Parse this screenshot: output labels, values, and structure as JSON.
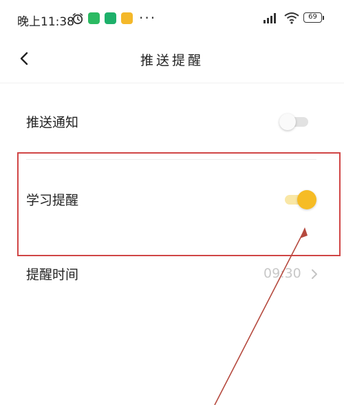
{
  "status_bar": {
    "time": "晚上11:38",
    "overflow": "···",
    "battery": "69",
    "icons": [
      "alarm-icon",
      "wechat-icon",
      "ring-app-icon",
      "note-app-icon",
      "signal-icon",
      "wifi-icon",
      "battery-icon"
    ]
  },
  "header": {
    "back_icon": "chevron-left-icon",
    "title": "推送提醒"
  },
  "settings": {
    "push_notification": {
      "label": "推送通知",
      "enabled": false
    },
    "study_reminder": {
      "label": "学习提醒",
      "enabled": true
    },
    "reminder_time": {
      "label": "提醒时间",
      "value": "09:30"
    }
  },
  "colors": {
    "toggle_on": "#f6bc25",
    "toggle_on_track": "#f9e7a6",
    "toggle_off_track": "#e2e2e2",
    "annotation": "#d04545"
  }
}
